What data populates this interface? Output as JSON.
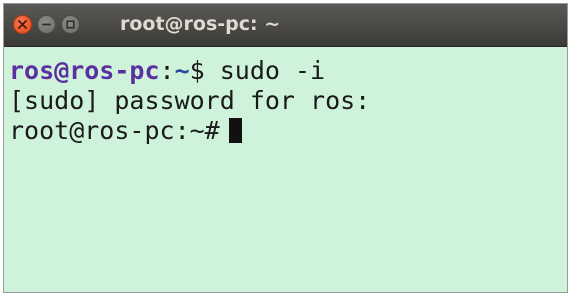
{
  "window": {
    "title": "root@ros-pc: ~"
  },
  "terminal": {
    "line1": {
      "user_host": "ros@ros-pc",
      "separator": ":",
      "path": "~",
      "prompt_symbol": "$",
      "command": " sudo -i"
    },
    "line2": {
      "text": "[sudo] password for ros:"
    },
    "line3": {
      "prompt": "root@ros-pc:~#"
    }
  },
  "colors": {
    "terminal_background": "#cff3da",
    "titlebar": "#3b3a36",
    "close_button": "#e2481c",
    "user_prompt": "#5a2fa0",
    "path_prompt": "#2e4a9e",
    "text": "#1a1a1a"
  },
  "icons": {
    "close": "close-icon",
    "minimize": "minimize-icon",
    "maximize": "maximize-icon"
  }
}
